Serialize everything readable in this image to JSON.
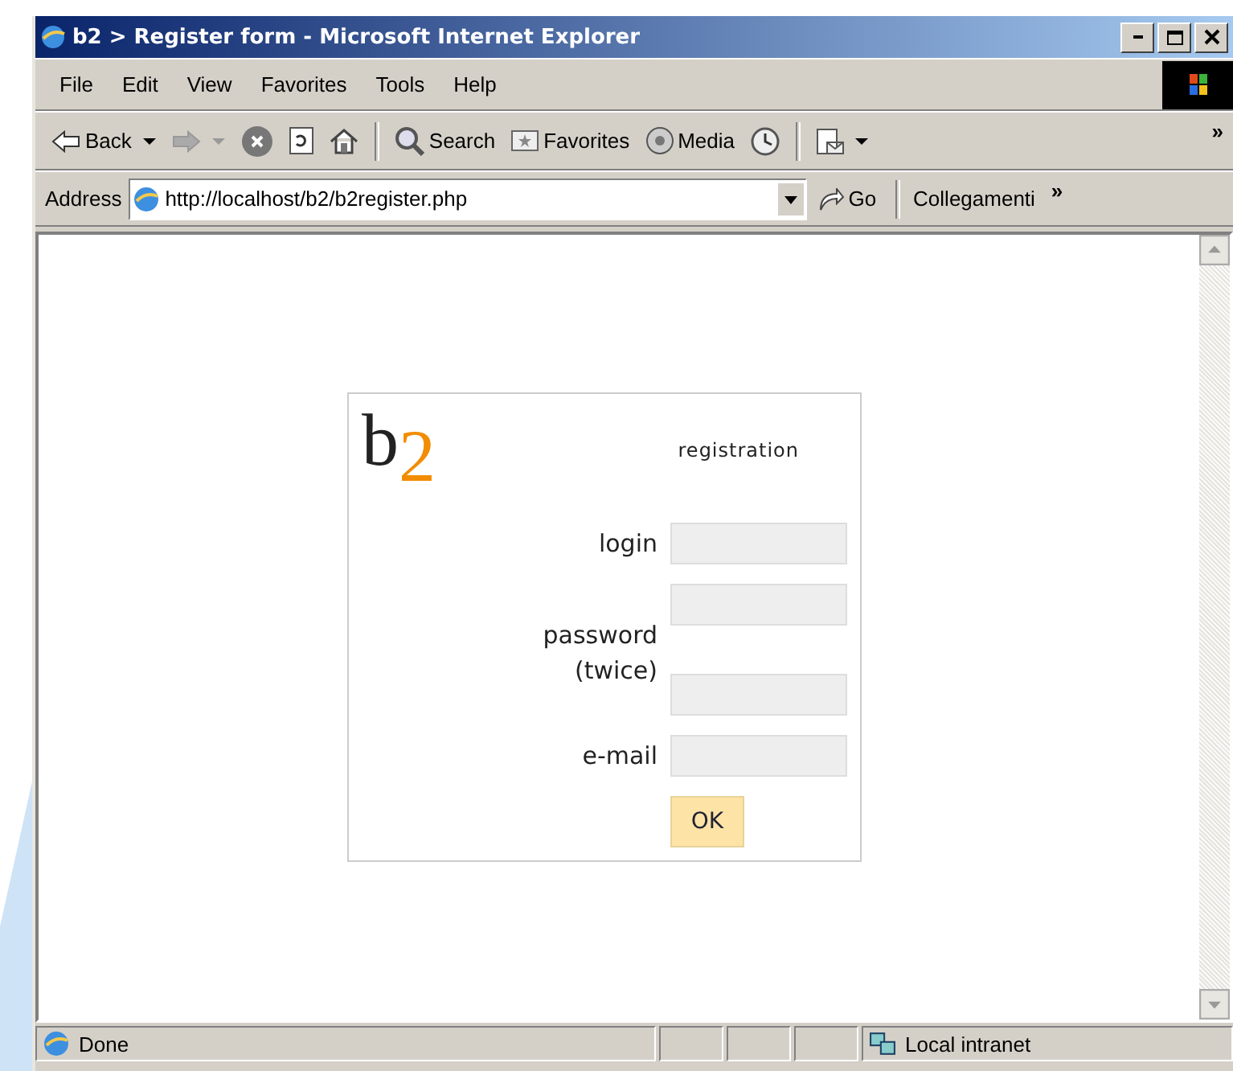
{
  "window": {
    "title": "b2 > Register form - Microsoft Internet Explorer"
  },
  "menu": [
    {
      "label": "File"
    },
    {
      "label": "Edit"
    },
    {
      "label": "View"
    },
    {
      "label": "Favorites"
    },
    {
      "label": "Tools"
    },
    {
      "label": "Help"
    }
  ],
  "toolbar": {
    "buttons": [
      {
        "kind": "back",
        "label": "Back",
        "disabled": false,
        "dropdown": true
      },
      {
        "kind": "forward",
        "disabled": true,
        "dropdown": true
      },
      {
        "kind": "stop"
      },
      {
        "kind": "refresh"
      },
      {
        "kind": "home"
      },
      {
        "kind": "separator"
      },
      {
        "kind": "search",
        "label": "Search"
      },
      {
        "kind": "favorites",
        "label": "Favorites"
      },
      {
        "kind": "media",
        "label": "Media"
      },
      {
        "kind": "history"
      },
      {
        "kind": "separator"
      },
      {
        "kind": "mail",
        "dropdown": true
      }
    ],
    "overflow": "»"
  },
  "address_bar": {
    "label": "Address",
    "url": "http://localhost/b2/b2register.php",
    "go": "Go",
    "links": "Collegamenti",
    "overflow": "»"
  },
  "page": {
    "logo": {
      "letter": "b",
      "digit": "2"
    },
    "heading": "registration",
    "form": {
      "login_label": "login",
      "password_label": [
        "password",
        "(twice)"
      ],
      "email_label": "e-mail",
      "submit": "OK"
    }
  },
  "status_bar": {
    "text": "Done",
    "zone": "Local intranet"
  }
}
